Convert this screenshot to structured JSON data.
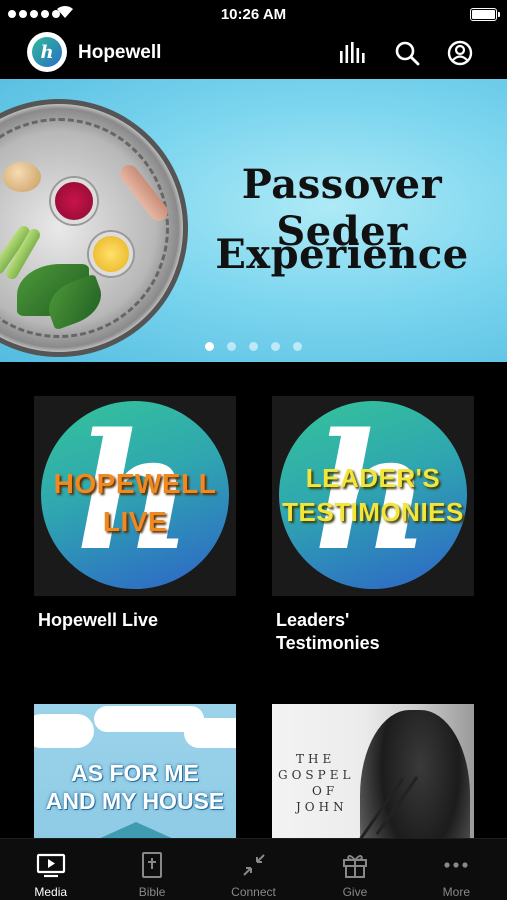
{
  "status_bar": {
    "time": "10:26 AM"
  },
  "header": {
    "logo_letter": "h",
    "title": "Hopewell",
    "icons": [
      "equalizer-icon",
      "search-icon",
      "account-icon"
    ]
  },
  "banner": {
    "title_line1": "Passover Seder",
    "title_line2": "Experience",
    "slide_count": 5,
    "active_slide": 1
  },
  "media_items": [
    {
      "thumb_text_line1": "HOPEWELL",
      "thumb_text_line2": "LIVE",
      "label": "Hopewell Live",
      "thumb_text_color": "#f0891f"
    },
    {
      "thumb_text_line1": "LEADER'S",
      "thumb_text_line2": "TESTIMONIES",
      "label_line1": "Leaders'",
      "label_line2": "Testimonies",
      "thumb_text_color": "#f3e63b"
    },
    {
      "thumb_text_line1": "AS FOR ME",
      "thumb_text_line2": "AND MY HOUSE"
    },
    {
      "thumb_text_line1": "THE",
      "thumb_text_line2": "GOSPEL",
      "thumb_text_line3": "OF",
      "thumb_text_line4": "JOHN"
    }
  ],
  "tabs": [
    {
      "label": "Media",
      "icon": "video-icon",
      "active": true
    },
    {
      "label": "Bible",
      "icon": "bible-icon",
      "active": false
    },
    {
      "label": "Connect",
      "icon": "connect-icon",
      "active": false
    },
    {
      "label": "Give",
      "icon": "gift-icon",
      "active": false
    },
    {
      "label": "More",
      "icon": "more-icon",
      "active": false
    }
  ],
  "colors": {
    "background": "#000000",
    "tab_bar": "#0d0d0d",
    "banner": "#7dd6ef",
    "accent_teal": "#35c49a",
    "accent_blue": "#2d63c8"
  }
}
